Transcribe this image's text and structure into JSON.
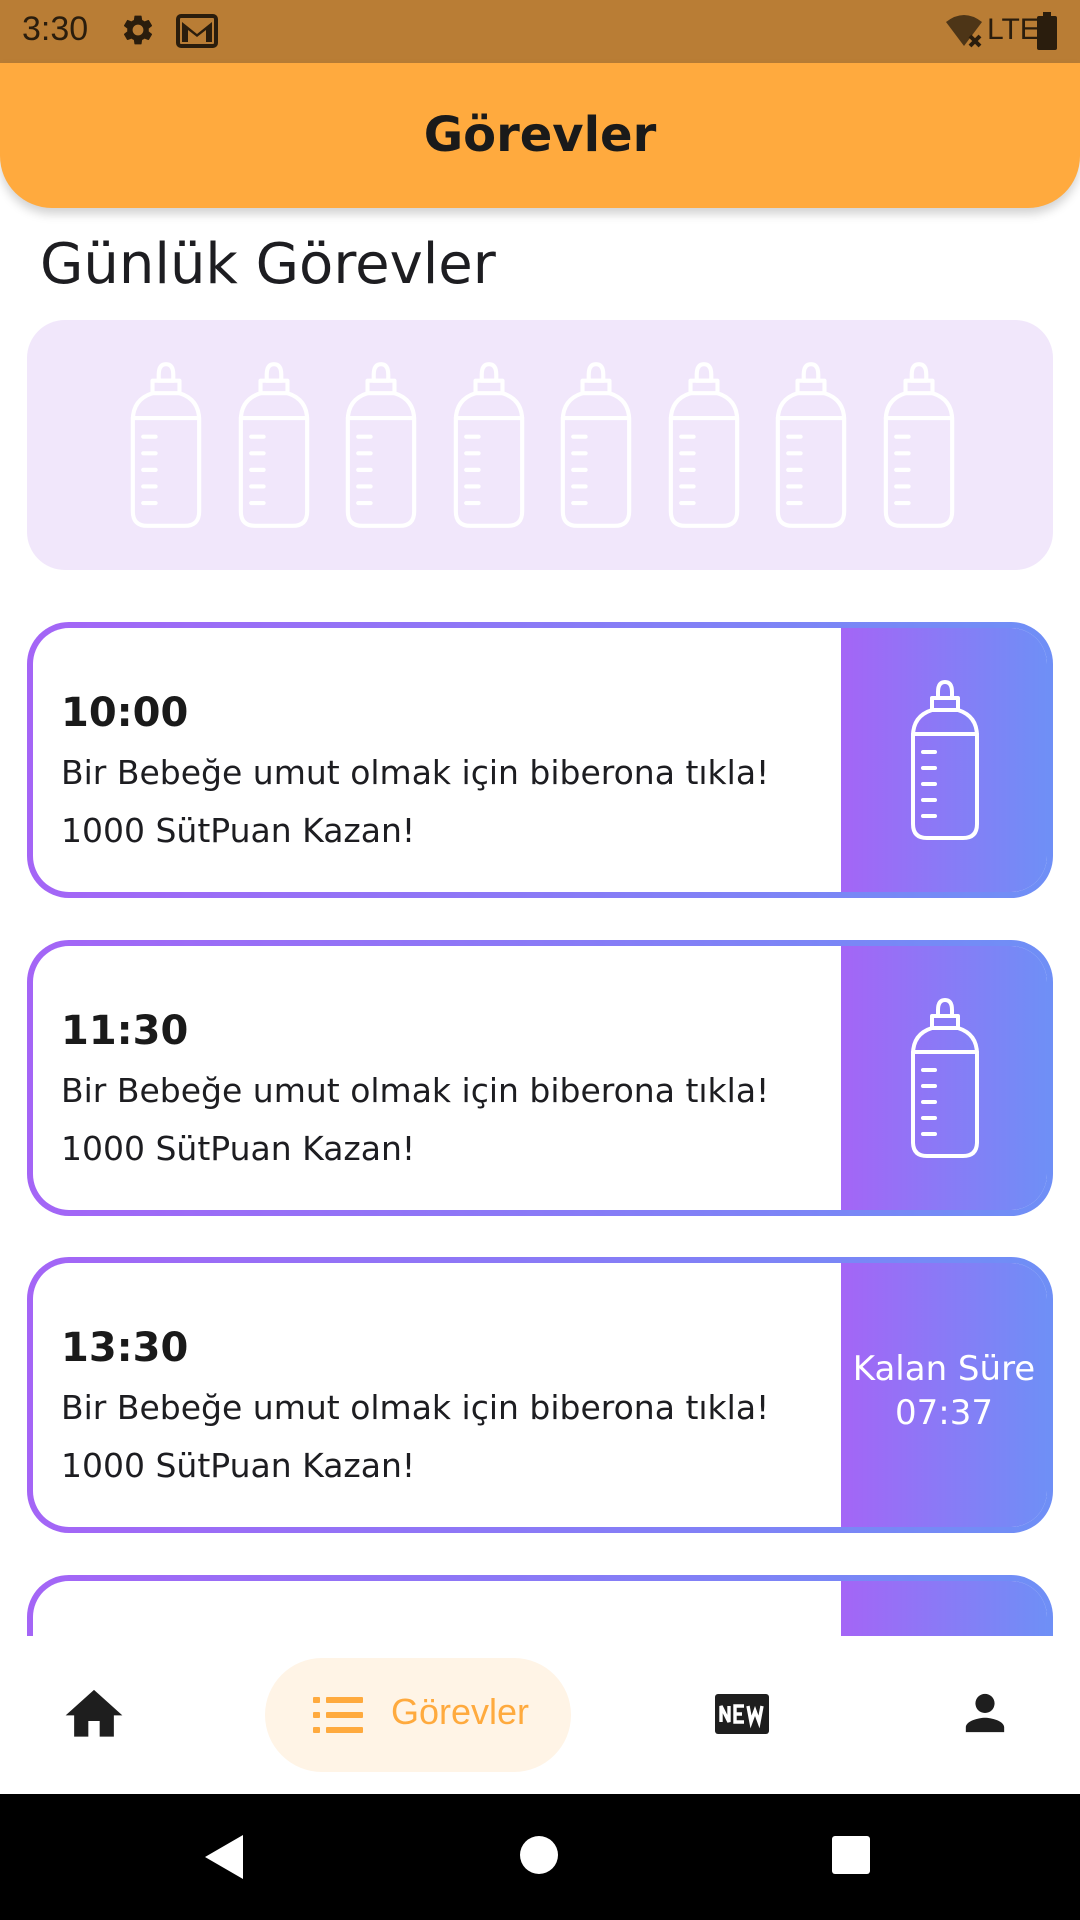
{
  "status_bar": {
    "time": "3:30",
    "network": "LTE",
    "icons": [
      "gear-icon",
      "mail-icon",
      "wifi-off-icon",
      "battery-icon"
    ],
    "background": "#b97d35"
  },
  "app_bar": {
    "title": "Görevler",
    "color": "#ffaa3e"
  },
  "section": {
    "title": "Günlük Görevler"
  },
  "progress": {
    "bottles_total": 8,
    "bottles_filled": 0,
    "icon": "baby-bottle-icon",
    "background": "#f1e7fb"
  },
  "tasks": [
    {
      "time": "10:00",
      "description": "Bir Bebeğe umut olmak için biberona tıkla!",
      "reward": "1000 SütPuan Kazan!",
      "action": "baby-bottle-icon"
    },
    {
      "time": "11:30",
      "description": "Bir Bebeğe umut olmak için biberona tıkla!",
      "reward": "1000 SütPuan Kazan!",
      "action": "baby-bottle-icon"
    },
    {
      "time": "13:30",
      "description": "Bir Bebeğe umut olmak için biberona tıkla!",
      "reward": "1000 SütPuan Kazan!",
      "timer_label": "Kalan Süre",
      "timer_value": "07:37"
    }
  ],
  "card_gradient": [
    "#a465f6",
    "#6f8ff6"
  ],
  "bottom_nav": {
    "items": [
      {
        "icon": "home-icon",
        "active": false
      },
      {
        "icon": "list-icon",
        "label": "Görevler",
        "active": true
      },
      {
        "icon": "new-badge-icon",
        "active": false
      },
      {
        "icon": "person-icon",
        "active": false
      }
    ],
    "active_color": "#ffaa3e"
  },
  "system_nav": {
    "icons": [
      "back-icon",
      "home-circle-icon",
      "recents-icon"
    ]
  }
}
